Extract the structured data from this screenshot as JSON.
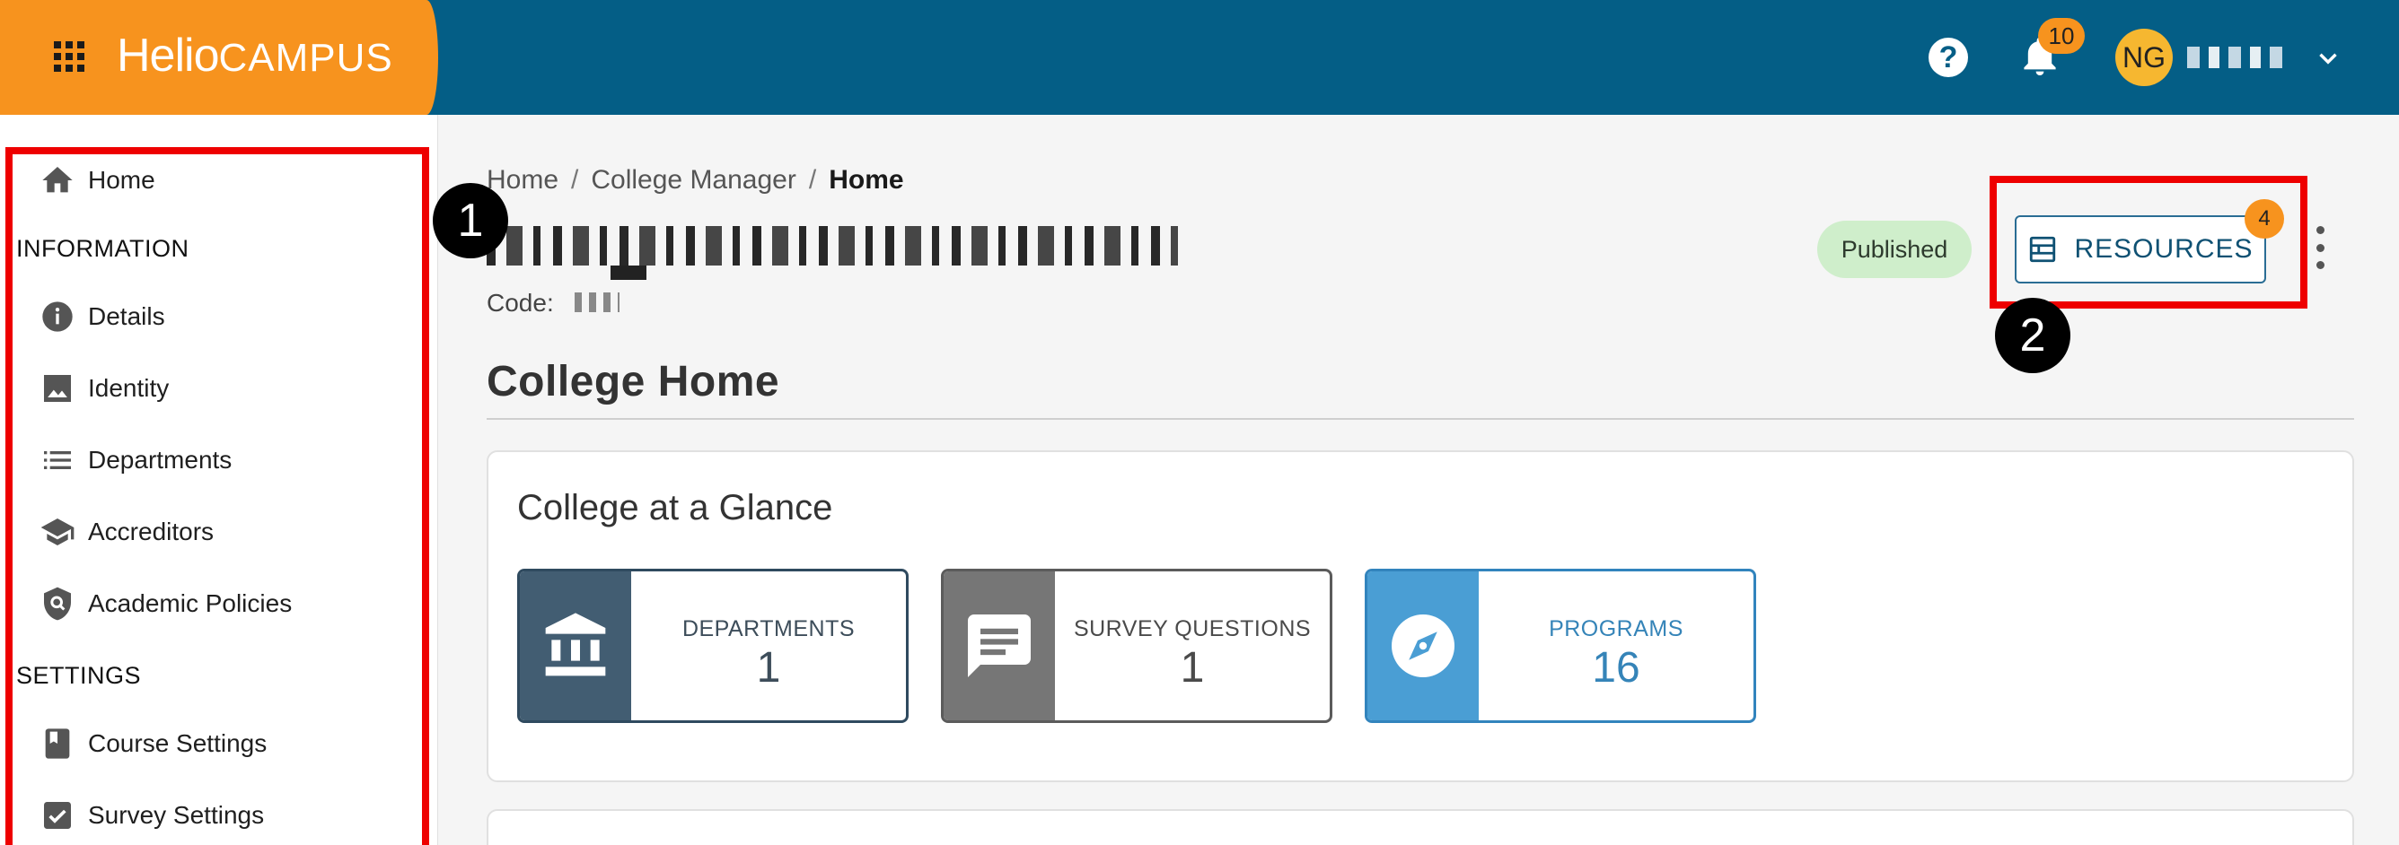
{
  "header": {
    "logo_bold": "Helio",
    "logo_light": "CAMPUS",
    "help_glyph": "?",
    "notifications_count": "10",
    "user_initials": "NG",
    "icons": [
      "apps-grid-icon",
      "help-icon",
      "bell-icon",
      "chevron-down-icon"
    ],
    "colors": {
      "topbar": "#045e86",
      "brand": "#f7931e",
      "avatar": "#f6b730"
    }
  },
  "sidebar": {
    "items": [
      {
        "label": "Home",
        "icon": "home-icon"
      },
      {
        "label": "Details",
        "icon": "info-icon"
      },
      {
        "label": "Identity",
        "icon": "image-icon"
      },
      {
        "label": "Departments",
        "icon": "list-icon"
      },
      {
        "label": "Accreditors",
        "icon": "school-cap-icon"
      },
      {
        "label": "Academic Policies",
        "icon": "shield-search-icon"
      },
      {
        "label": "Course Settings",
        "icon": "book-icon"
      },
      {
        "label": "Survey Settings",
        "icon": "checkbox-icon"
      }
    ],
    "headings": [
      "INFORMATION",
      "SETTINGS"
    ]
  },
  "breadcrumb": {
    "items": [
      "Home",
      "College Manager",
      "Home"
    ],
    "separator": "/"
  },
  "record": {
    "code_label": "Code:",
    "status": "Published",
    "resources_label": "RESOURCES",
    "resources_count": "4"
  },
  "steps": [
    "1",
    "2"
  ],
  "main": {
    "section_title": "College Home",
    "glance_title": "College at a Glance",
    "tiles": [
      {
        "caption": "DEPARTMENTS",
        "value": "1",
        "icon": "institution-icon",
        "color": "#425d72"
      },
      {
        "caption": "SURVEY QUESTIONS",
        "value": "1",
        "icon": "comment-icon",
        "color": "#767676"
      },
      {
        "caption": "PROGRAMS",
        "value": "16",
        "icon": "compass-icon",
        "color": "#4a9ed4"
      }
    ]
  }
}
